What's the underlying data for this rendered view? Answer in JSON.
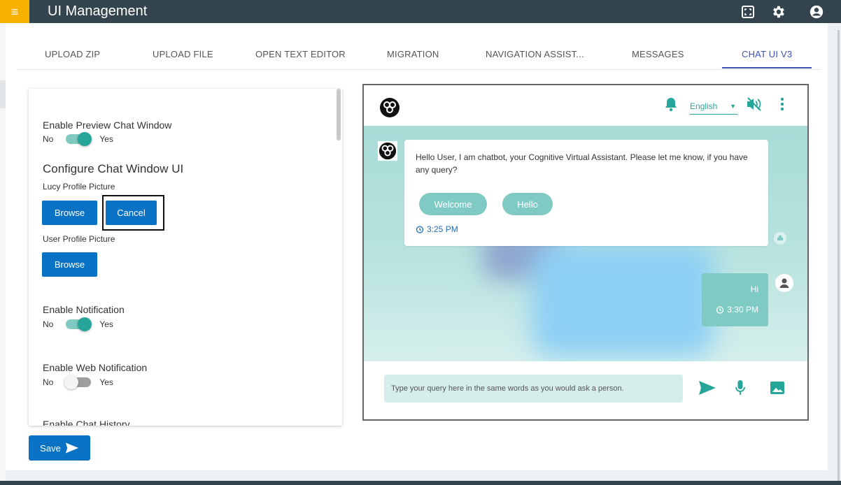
{
  "app": {
    "title": "UI Management",
    "menu_icon": "hamburger-icon"
  },
  "topbar_icons": [
    "fullscreen-icon",
    "gear-icon",
    "account-icon"
  ],
  "tabs": [
    {
      "label": "UPLOAD ZIP"
    },
    {
      "label": "UPLOAD FILE"
    },
    {
      "label": "OPEN TEXT EDITOR"
    },
    {
      "label": "MIGRATION"
    },
    {
      "label": "NAVIGATION ASSIST..."
    },
    {
      "label": "MESSAGES"
    },
    {
      "label": "CHAT UI V3",
      "active": true
    }
  ],
  "settings": {
    "preview_label": "Enable Preview Chat Window",
    "preview_no": "No",
    "preview_yes": "Yes",
    "preview_on": true,
    "configure_title": "Configure Chat Window UI",
    "lucy_label": "Lucy Profile Picture",
    "browse_label": "Browse",
    "cancel_label": "Cancel",
    "user_label": "User Profile Picture",
    "browse2_label": "Browse",
    "notif_label": "Enable Notification",
    "notif_no": "No",
    "notif_yes": "Yes",
    "notif_on": true,
    "web_notif_label": "Enable Web Notification",
    "web_no": "No",
    "web_yes": "Yes",
    "web_on": false,
    "history_label": "Enable Chat History"
  },
  "save": {
    "label": "Save"
  },
  "chat": {
    "language": "English",
    "bot_message": "Hello User, I am chatbot, your Cognitive Virtual Assistant. Please let me know, if you have any query?",
    "quick_replies": [
      "Welcome",
      "Hello"
    ],
    "bot_time": "3:25 PM",
    "user_message": "Hi",
    "user_time": "3:30 PM",
    "input_placeholder": "Type your query here in the same words as you would ask a person.",
    "colors": {
      "accent": "#26a69a",
      "bubble": "#7fcbc3",
      "link": "#1f6bb5"
    }
  },
  "colors": {
    "topbar": "#34444f",
    "menu": "#f7b000",
    "primary": "#0a72c4",
    "tab_active": "#3f51b5"
  }
}
